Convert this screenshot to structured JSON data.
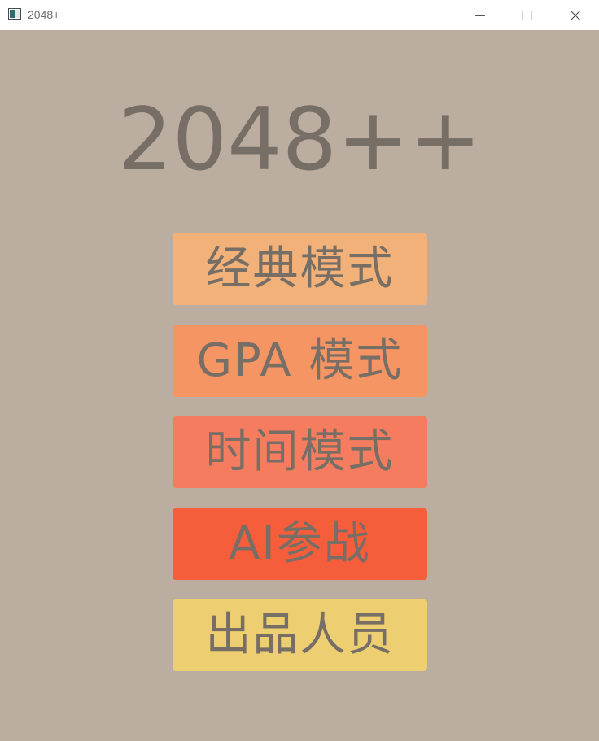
{
  "window": {
    "title": "2048++",
    "icon": "app-window-icon",
    "controls": {
      "minimize_icon": "minimize-icon",
      "maximize_icon": "maximize-icon",
      "close_icon": "close-icon"
    }
  },
  "main": {
    "title": "2048++",
    "buttons": [
      {
        "label": "经典模式",
        "color": "#f2b179"
      },
      {
        "label": "GPA 模式",
        "color": "#f59563"
      },
      {
        "label": "时间模式",
        "color": "#f67c5f"
      },
      {
        "label": "AI参战",
        "color": "#f65e3b"
      },
      {
        "label": "出品人员",
        "color": "#edcf72"
      }
    ]
  },
  "colors": {
    "background": "#bbad9f",
    "text": "#776e65",
    "titlebar": "#ffffff"
  }
}
